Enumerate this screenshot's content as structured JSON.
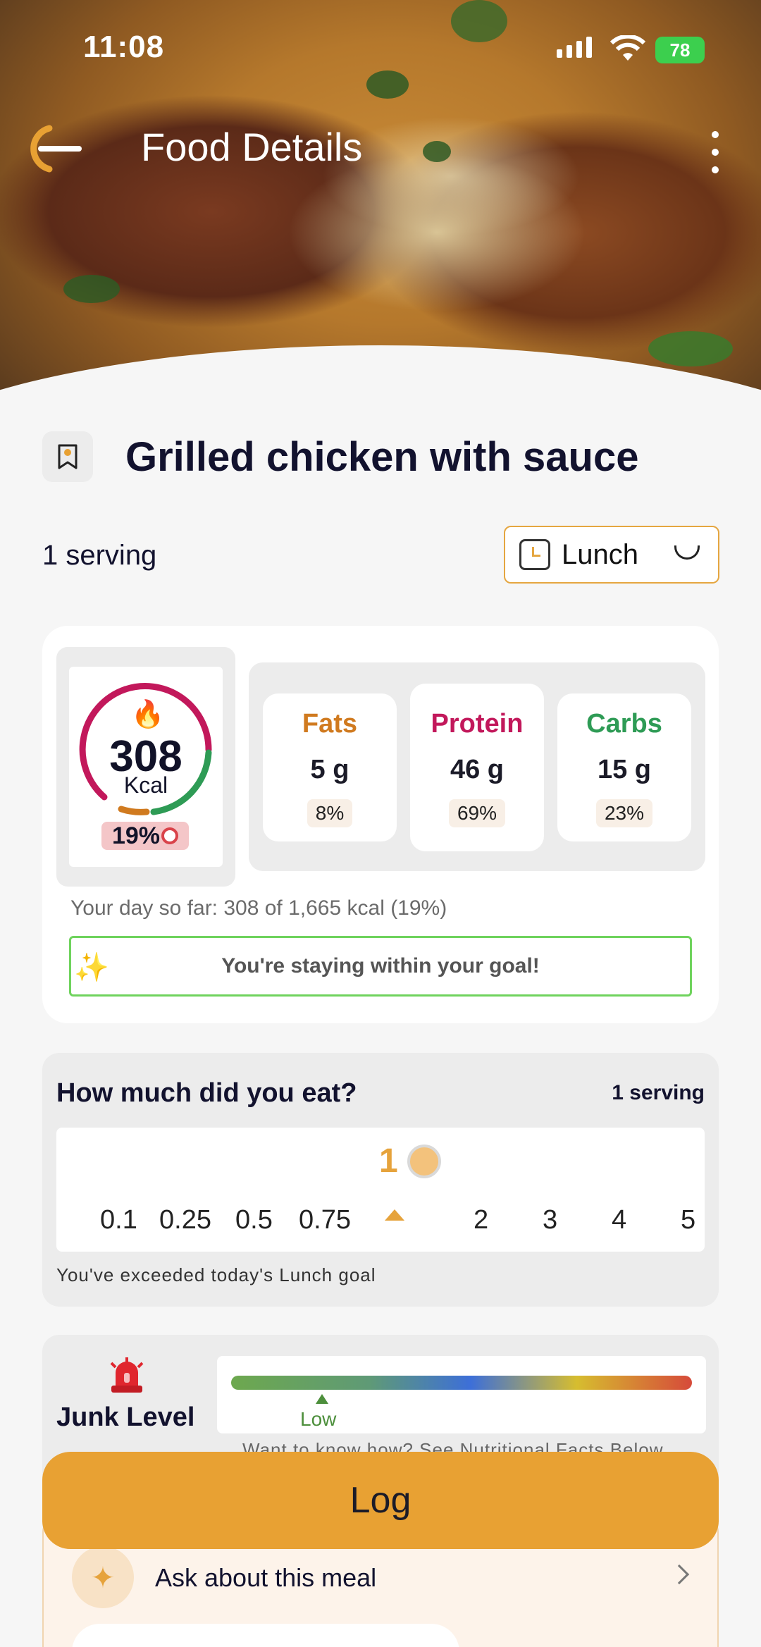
{
  "status_bar": {
    "time": "11:08",
    "battery": "78"
  },
  "header": {
    "title": "Food Details"
  },
  "food": {
    "name": "Grilled chicken with sauce",
    "serving": "1 serving",
    "meal": "Lunch"
  },
  "calories": {
    "value": "308",
    "unit": "Kcal",
    "percent": "19%",
    "ring_fraction": 0.19
  },
  "macros": [
    {
      "name": "Fats",
      "value": "5 g",
      "percent": "8%",
      "color": "#d07a1f"
    },
    {
      "name": "Protein",
      "value": "46 g",
      "percent": "69%",
      "color": "#c2185b"
    },
    {
      "name": "Carbs",
      "value": "15 g",
      "percent": "23%",
      "color": "#2e9b55"
    }
  ],
  "day_summary": "Your day so far: 308 of 1,665 kcal (19%)",
  "goal_message": "You're staying within your goal!",
  "portion": {
    "question": "How much did you eat?",
    "serving": "1 serving",
    "selected": "1",
    "ticks": [
      "0.1",
      "0.25",
      "0.5",
      "0.75",
      "2",
      "3",
      "4",
      "5"
    ],
    "warning": "You've exceeded today's Lunch goal"
  },
  "junk": {
    "label": "Junk Level",
    "level": "Low",
    "hint": "Want to know how? See Nutritional Facts Below"
  },
  "ask": {
    "label": "Ask about this meal"
  },
  "log_button": "Log",
  "colors": {
    "accent": "#e8a133",
    "goal_border": "#6fd35d"
  }
}
